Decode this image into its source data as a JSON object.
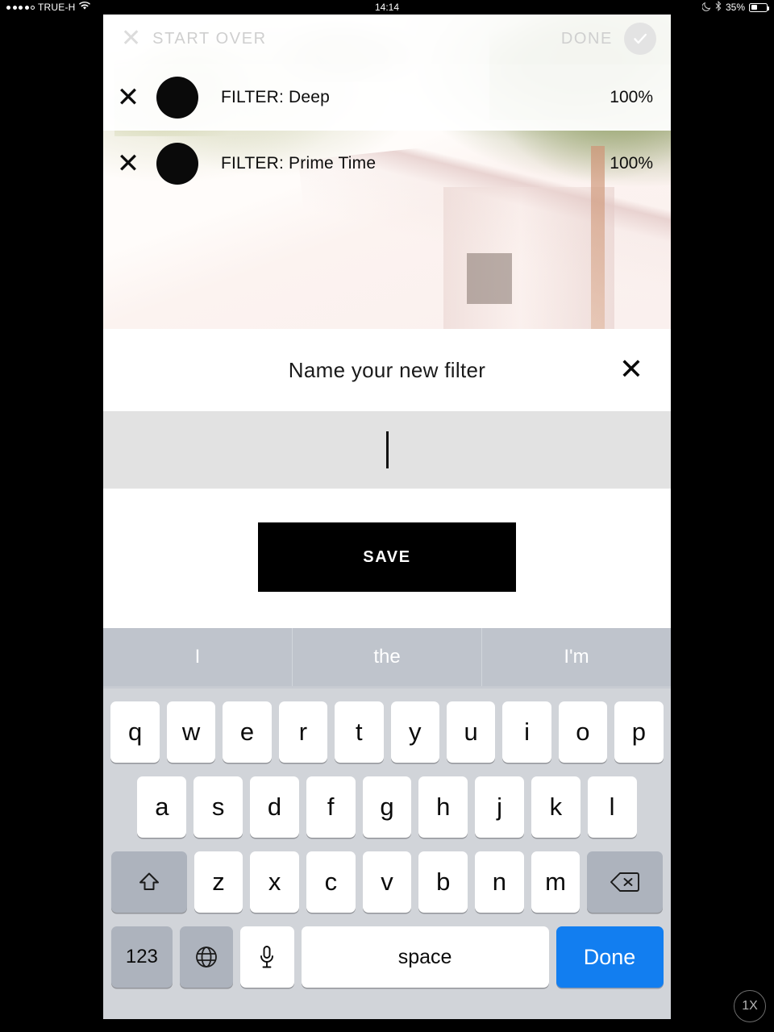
{
  "status_bar": {
    "carrier": "TRUE-H",
    "time": "14:14",
    "battery_percent": "35%",
    "signal_dots_filled": 4,
    "signal_dots_total": 5,
    "wifi_icon": "wifi-icon",
    "moon_icon": "moon-icon",
    "bluetooth_icon": "bluetooth-icon"
  },
  "toolbar": {
    "close_icon": "close-icon",
    "start_over_label": "START OVER",
    "done_label": "DONE",
    "confirm_icon": "check-circle-icon"
  },
  "filters": [
    {
      "delete_icon": "close-icon",
      "swatch": "black-circle-icon",
      "label": "FILTER: Deep",
      "amount": "100%"
    },
    {
      "delete_icon": "close-icon",
      "swatch": "black-circle-icon",
      "label": "FILTER: Prime Time",
      "amount": "100%"
    }
  ],
  "sheet": {
    "title": "Name your new filter",
    "close_icon": "close-icon",
    "input_value": "",
    "input_placeholder": "",
    "save_label": "SAVE"
  },
  "keyboard": {
    "predictions": [
      "I",
      "the",
      "I'm"
    ],
    "row1": [
      "q",
      "w",
      "e",
      "r",
      "t",
      "y",
      "u",
      "i",
      "o",
      "p"
    ],
    "row2": [
      "a",
      "s",
      "d",
      "f",
      "g",
      "h",
      "j",
      "k",
      "l"
    ],
    "row3_letters": [
      "z",
      "x",
      "c",
      "v",
      "b",
      "n",
      "m"
    ],
    "shift_icon": "shift-arrow-icon",
    "backspace_icon": "backspace-icon",
    "numbers_label": "123",
    "globe_icon": "globe-icon",
    "mic_icon": "microphone-icon",
    "space_label": "space",
    "return_label": "Done"
  },
  "zoom_badge": {
    "label": "1X"
  },
  "colors": {
    "accent_blue": "#127ef0",
    "keyboard_bg": "#d1d4d9",
    "prediction_bg": "#bfc4cc",
    "input_bg": "#e2e2e2",
    "toolbar_text": "#cfcfcf"
  }
}
